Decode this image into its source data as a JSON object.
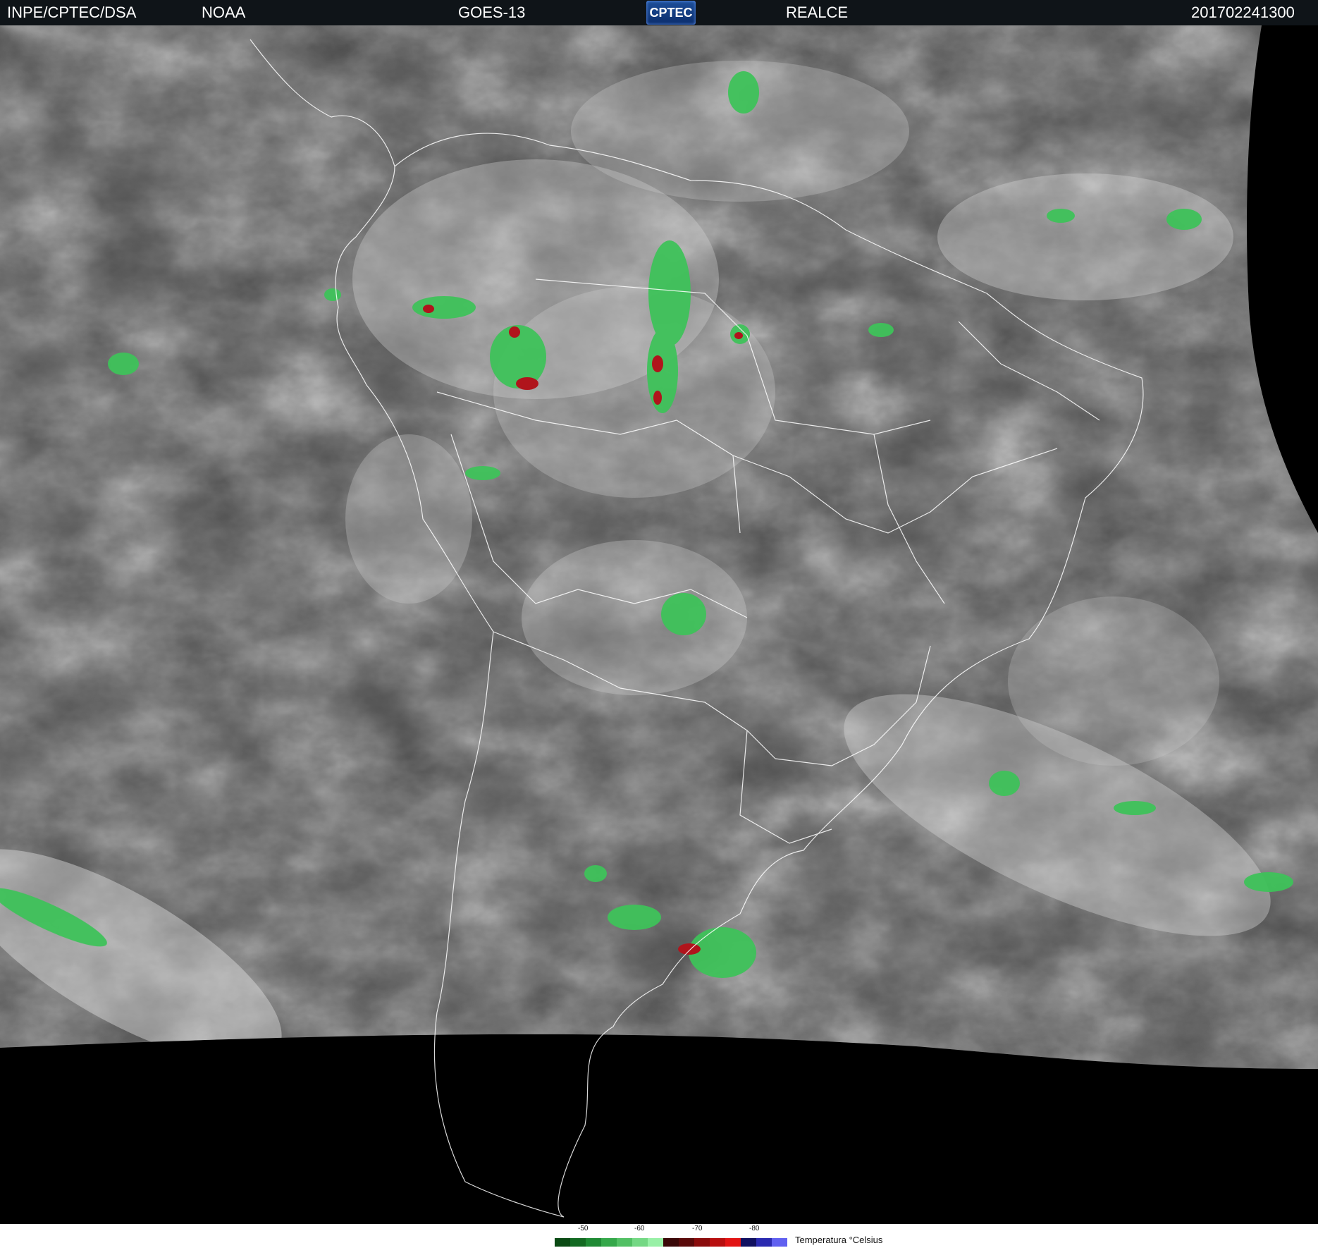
{
  "header": {
    "source": "INPE/CPTEC/DSA",
    "agency": "NOAA",
    "satellite": "GOES-13",
    "logo_text": "CPTEC",
    "product": "REALCE",
    "timestamp": "201702241300"
  },
  "legend": {
    "title": "Temperatura °Celsius",
    "ticks": [
      "-50",
      "-60",
      "-70",
      "-80"
    ],
    "colors": [
      "#0a4a14",
      "#136a22",
      "#1f8a34",
      "#35a84a",
      "#52c064",
      "#74d884",
      "#98f0a6",
      "#3a0808",
      "#5a0a0a",
      "#8a0c0c",
      "#b80f0f",
      "#e21414",
      "#101060",
      "#2a2ab0",
      "#6060f0"
    ]
  },
  "palette": {
    "space": "#000000",
    "cloud_dark": "#3e3e3e",
    "cloud_mid": "#8a8a8a",
    "cloud_bright": "#dcdcdc",
    "cold_green": "#3fc25a",
    "very_cold_red": "#b0141c",
    "border": "#ffffff"
  }
}
